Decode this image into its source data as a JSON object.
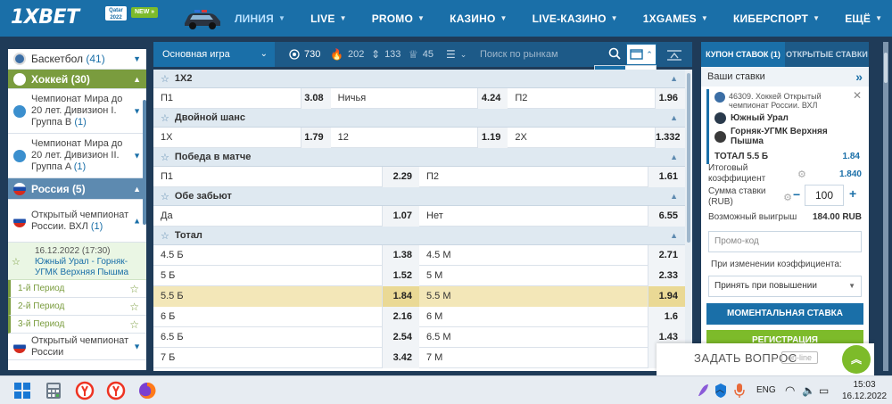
{
  "header": {
    "logo": "1XBET",
    "logo_badge": "Qatar 2022",
    "new_badge": "NEW »",
    "nav": [
      {
        "label": "ЛИНИЯ",
        "has_dropdown": true,
        "active": true
      },
      {
        "label": "LIVE",
        "has_dropdown": true
      },
      {
        "label": "PROMO",
        "has_dropdown": true
      },
      {
        "label": "КАЗИНО",
        "has_dropdown": true
      },
      {
        "label": "LIVE-КАЗИНО",
        "has_dropdown": true
      },
      {
        "label": "1XGAMES",
        "has_dropdown": true
      },
      {
        "label": "КИБЕРСПОРТ",
        "has_dropdown": true
      },
      {
        "label": "ЕЩЁ",
        "has_dropdown": true
      }
    ]
  },
  "sidebar": {
    "sport_basketball": "Баскетбол",
    "sport_basketball_count": "(41)",
    "cat_hockey": "Хоккей (30)",
    "league_1": "Чемпионат Мира до 20 лет. Дивизион I. Группа B",
    "league_1_count": "(1)",
    "league_2": "Чемпионат Мира до 20 лет. Дивизион II. Группа A",
    "league_2_count": "(1)",
    "cat_russia": "Россия (5)",
    "league_3": "Открытый чемпионат России. ВХЛ",
    "league_3_count": "(1)",
    "match_time": "16.12.2022 (17:30)",
    "match_teams": "Южный Урал - Горняк-УГМК Верхняя Пышма",
    "periods": [
      "1-й Период",
      "2-й Период",
      "3-й Период"
    ],
    "league_4": "Открытый чемпионат России"
  },
  "toolbar": {
    "select_label": "Основная игра",
    "stats": [
      {
        "icon": "target-icon",
        "count": "730",
        "active": true
      },
      {
        "icon": "fire-icon",
        "count": "202"
      },
      {
        "icon": "up-down-icon",
        "count": "133"
      },
      {
        "icon": "trophy-icon",
        "count": "45"
      },
      {
        "icon": "list-icon",
        "count": ""
      }
    ],
    "search_placeholder": "Поиск по рынкам"
  },
  "markets": [
    {
      "title": "1X2",
      "rows": [
        [
          {
            "label": "П1",
            "odd": "3.08"
          },
          {
            "label": "Ничья",
            "odd": "4.24"
          },
          {
            "label": "П2",
            "odd": "1.96"
          }
        ]
      ]
    },
    {
      "title": "Двойной шанс",
      "rows": [
        [
          {
            "label": "1X",
            "odd": "1.79"
          },
          {
            "label": "12",
            "odd": "1.19"
          },
          {
            "label": "2X",
            "odd": "1.332"
          }
        ]
      ]
    },
    {
      "title": "Победа в матче",
      "rows": [
        [
          {
            "label": "П1",
            "odd": "2.29"
          },
          {
            "label": "П2",
            "odd": "1.61"
          }
        ]
      ]
    },
    {
      "title": "Обе забьют",
      "rows": [
        [
          {
            "label": "Да",
            "odd": "1.07"
          },
          {
            "label": "Нет",
            "odd": "6.55"
          }
        ]
      ]
    },
    {
      "title": "Тотал",
      "rows": [
        [
          {
            "label": "4.5 Б",
            "odd": "1.38"
          },
          {
            "label": "4.5 М",
            "odd": "2.71"
          }
        ],
        [
          {
            "label": "5 Б",
            "odd": "1.52"
          },
          {
            "label": "5 М",
            "odd": "2.33"
          }
        ],
        [
          {
            "label": "5.5 Б",
            "odd": "1.84",
            "highlight": true
          },
          {
            "label": "5.5 М",
            "odd": "1.94"
          }
        ],
        [
          {
            "label": "6 Б",
            "odd": "2.16"
          },
          {
            "label": "6 М",
            "odd": "1.6"
          }
        ],
        [
          {
            "label": "6.5 Б",
            "odd": "2.54"
          },
          {
            "label": "6.5 М",
            "odd": "1.43"
          }
        ],
        [
          {
            "label": "7 Б",
            "odd": "3.42"
          },
          {
            "label": "7 М",
            "odd": ""
          }
        ]
      ]
    }
  ],
  "coupon": {
    "tab_coupon": "КУПОН СТАВОК (1)",
    "tab_open": "ОТКРЫТЫЕ СТАВКИ",
    "your_bets": "Ваши ставки",
    "bet_event": "46309. Хоккей Открытый чемпионат России. ВХЛ",
    "bet_team1": "Южный Урал",
    "bet_team2": "Горняк-УГМК Верхняя Пышма",
    "bet_total_label": "ТОТАЛ 5.5 Б",
    "bet_total_odd": "1.84",
    "final_coef_label": "Итоговый коэффициент",
    "final_coef_value": "1.840",
    "stake_label": "Сумма ставки (RUB)",
    "stake_value": "100",
    "win_label": "Возможный выигрыш",
    "win_value": "184.00 RUB",
    "promo_placeholder": "Промо-код",
    "change_label": "При изменении коэффициента:",
    "change_value": "Принять при повышении",
    "quick_button": "МОМЕНТАЛЬНАЯ СТАВКА",
    "register_button": "РЕГИСТРАЦИЯ"
  },
  "ask": {
    "text": "ЗАДАТЬ ВОПРОС",
    "status": "on-line"
  },
  "taskbar": {
    "lang": "ENG",
    "time": "15:03",
    "date": "16.12.2022"
  },
  "colors": {
    "header_blue": "#1a6fa8",
    "dark_blue": "#1d5a88",
    "green": "#7dbb2a",
    "highlight": "#f3e7b8"
  }
}
